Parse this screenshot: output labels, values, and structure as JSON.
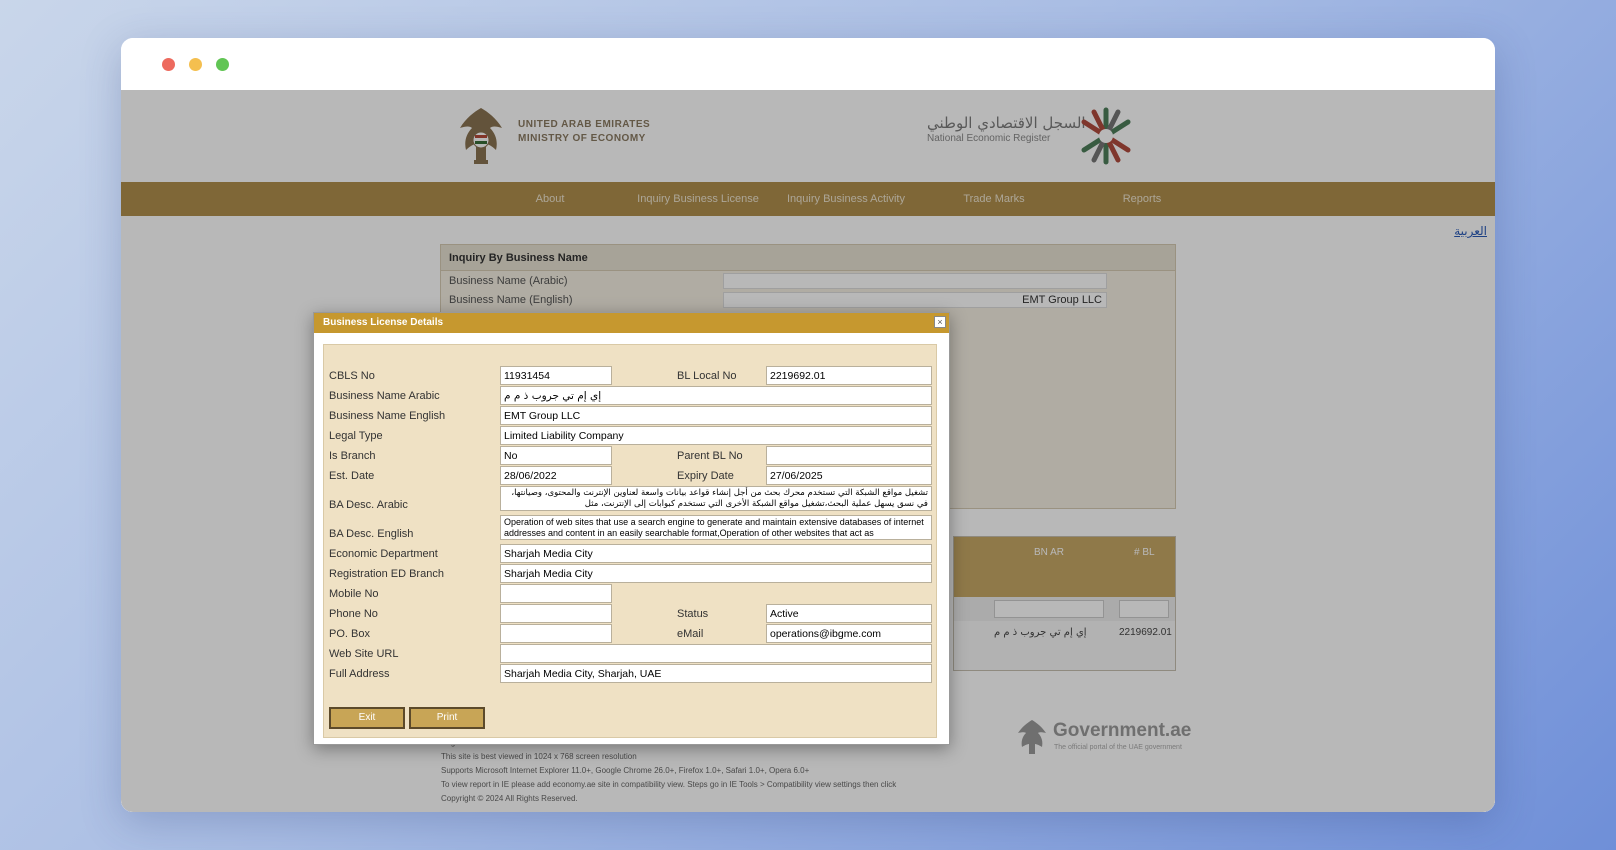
{
  "header": {
    "moe_line1": "UNITED ARAB EMIRATES",
    "moe_line2": "MINISTRY OF ECONOMY",
    "ner_arabic": "السجل الاقتصادي الوطني",
    "ner_english": "National Economic Register",
    "emblem_icon": "uae-falcon-emblem-icon",
    "ner_logo_icon": "ner-star-logo-icon"
  },
  "nav": {
    "items": [
      {
        "label": "About"
      },
      {
        "label": "Inquiry Business License"
      },
      {
        "label": "Inquiry Business Activity"
      },
      {
        "label": "Trade Marks"
      },
      {
        "label": "Reports"
      }
    ]
  },
  "language_link": "العربية",
  "inquiry": {
    "title": "Inquiry By Business Name",
    "arabic_label": "Business Name (Arabic)",
    "arabic_value": "",
    "english_label": "Business Name (English)",
    "english_value": "EMT Group LLC"
  },
  "results": {
    "col_bn_ar": "BN AR",
    "col_bl": "# BL",
    "row_bn_ar": "إي إم تي جروب ذ م م",
    "row_bl": "2219692.01"
  },
  "footer": {
    "line1": "Page last modified on 12/12/2021 2:00 PM",
    "line2": "This site is best viewed in 1024 x 768 screen resolution",
    "line3": "Supports Microsoft Internet Explorer 11.0+, Google Chrome 26.0+, Firefox 1.0+, Safari 1.0+, Opera 6.0+",
    "line4": "To view report in IE please add economy.ae site in compatibility view. Steps go in IE Tools > Compatibility view settings then click",
    "line5": "Copyright © 2024 All Rights Reserved.",
    "gov_title": "Government.ae",
    "gov_sub": "The official portal of the UAE government"
  },
  "dialog": {
    "title": "Business License Details",
    "close_icon": "close-icon",
    "labels": {
      "cbls_no": "CBLS No",
      "bl_local_no": "BL Local No",
      "business_name_arabic": "Business Name Arabic",
      "business_name_english": "Business Name English",
      "legal_type": "Legal Type",
      "is_branch": "Is Branch",
      "parent_bl_no": "Parent BL No",
      "est_date": "Est. Date",
      "expiry_date": "Expiry Date",
      "ba_desc_arabic": "BA Desc. Arabic",
      "ba_desc_english": "BA Desc. English",
      "economic_department": "Economic Department",
      "registration_ed_branch": "Registration ED Branch",
      "mobile_no": "Mobile No",
      "phone_no": "Phone No",
      "status": "Status",
      "po_box": "PO. Box",
      "email": "eMail",
      "web_site_url": "Web Site URL",
      "full_address": "Full Address"
    },
    "values": {
      "cbls_no": "11931454",
      "bl_local_no": "2219692.01",
      "business_name_arabic": "إي إم تي جروب ذ م م",
      "business_name_english": "EMT Group LLC",
      "legal_type": "Limited Liability Company",
      "is_branch": "No",
      "parent_bl_no": "",
      "est_date": "28/06/2022",
      "expiry_date": "27/06/2025",
      "ba_desc_arabic": "تشغيل مواقع الشبكة التي تستخدم محرك بحث من أجل إنشاء قواعد بيانات واسعة لعناوين الإنترنت والمحتوى، وصيانتها، في نسق يسهل عملية البحث،تشغيل مواقع الشبكة الأخرى التي تستخدم كبوابات إلى الإنترنت، مثل",
      "ba_desc_english": "Operation of web sites that use a search engine to generate and maintain extensive databases of internet addresses and content in an easily searchable format,Operation of other websites that act as",
      "economic_department": "Sharjah Media City",
      "registration_ed_branch": "Sharjah Media City",
      "mobile_no": "",
      "phone_no": "",
      "status": "Active",
      "po_box": "",
      "email": "operations@ibgme.com",
      "web_site_url": "",
      "full_address": "Sharjah Media City, Sharjah, UAE"
    },
    "buttons": {
      "exit": "Exit",
      "print": "Print"
    }
  }
}
